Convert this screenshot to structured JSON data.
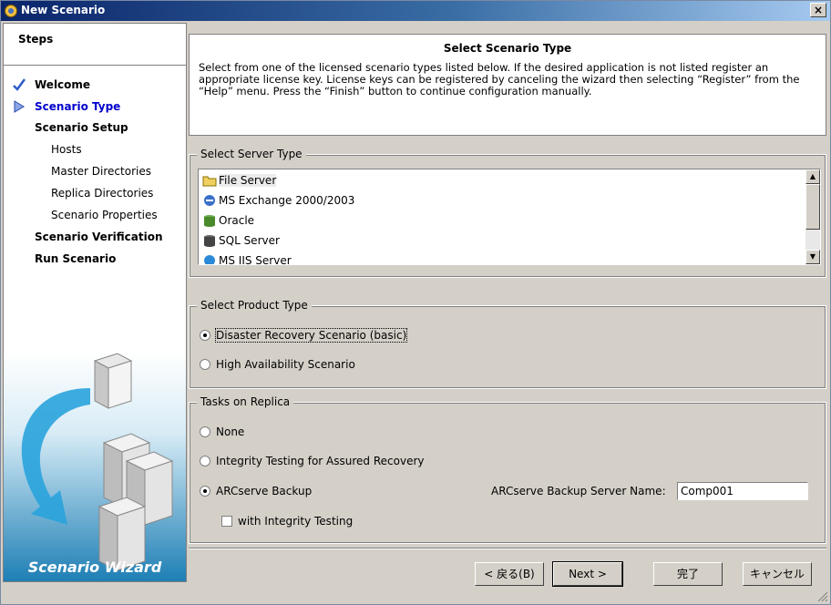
{
  "window": {
    "title": "New Scenario",
    "close": "×"
  },
  "steps": {
    "heading": "Steps",
    "items": [
      {
        "label": "Welcome",
        "level": "main",
        "state": "done"
      },
      {
        "label": "Scenario Type",
        "level": "main",
        "state": "current"
      },
      {
        "label": "Scenario Setup",
        "level": "main",
        "state": "pending"
      },
      {
        "label": "Hosts",
        "level": "sub",
        "state": "pending"
      },
      {
        "label": "Master Directories",
        "level": "sub",
        "state": "pending"
      },
      {
        "label": "Replica Directories",
        "level": "sub",
        "state": "pending"
      },
      {
        "label": "Scenario Properties",
        "level": "sub",
        "state": "pending"
      },
      {
        "label": "Scenario Verification",
        "level": "main",
        "state": "pending"
      },
      {
        "label": "Run Scenario",
        "level": "main",
        "state": "pending"
      }
    ],
    "wizard_caption": "Scenario Wizard"
  },
  "header": {
    "title": "Select Scenario Type",
    "description": "Select from one of the licensed scenario types listed below.  If the desired application is not listed register an appropriate license key.  License keys can be registered by canceling the wizard then selecting “Register” from the “Help” menu. Press the “Finish” button to continue configuration manually."
  },
  "server_type": {
    "legend": "Select Server Type",
    "items": [
      {
        "label": "File Server",
        "icon": "folder-icon",
        "selected": true
      },
      {
        "label": "MS Exchange 2000/2003",
        "icon": "exchange-icon",
        "selected": false
      },
      {
        "label": "Oracle",
        "icon": "database-icon",
        "selected": false
      },
      {
        "label": "SQL Server",
        "icon": "sql-server-icon",
        "selected": false
      },
      {
        "label": "MS IIS Server",
        "icon": "iis-icon",
        "selected": false
      }
    ]
  },
  "product_type": {
    "legend": "Select Product Type",
    "options": [
      {
        "label": "Disaster Recovery Scenario (basic)",
        "checked": true
      },
      {
        "label": "High Availability Scenario",
        "checked": false
      }
    ]
  },
  "tasks": {
    "legend": "Tasks on Replica",
    "options": [
      {
        "label": "None",
        "checked": false
      },
      {
        "label": "Integrity Testing for Assured Recovery",
        "checked": false
      },
      {
        "label": "ARCserve Backup",
        "checked": true
      }
    ],
    "server_name_label": "ARCserve Backup Server Name:",
    "server_name_value": "Comp001",
    "with_integrity_label": "with Integrity Testing",
    "with_integrity_checked": false
  },
  "buttons": {
    "back": "< 戻る(B)",
    "next": "Next >",
    "finish": "完了",
    "cancel": "キャンセル"
  }
}
